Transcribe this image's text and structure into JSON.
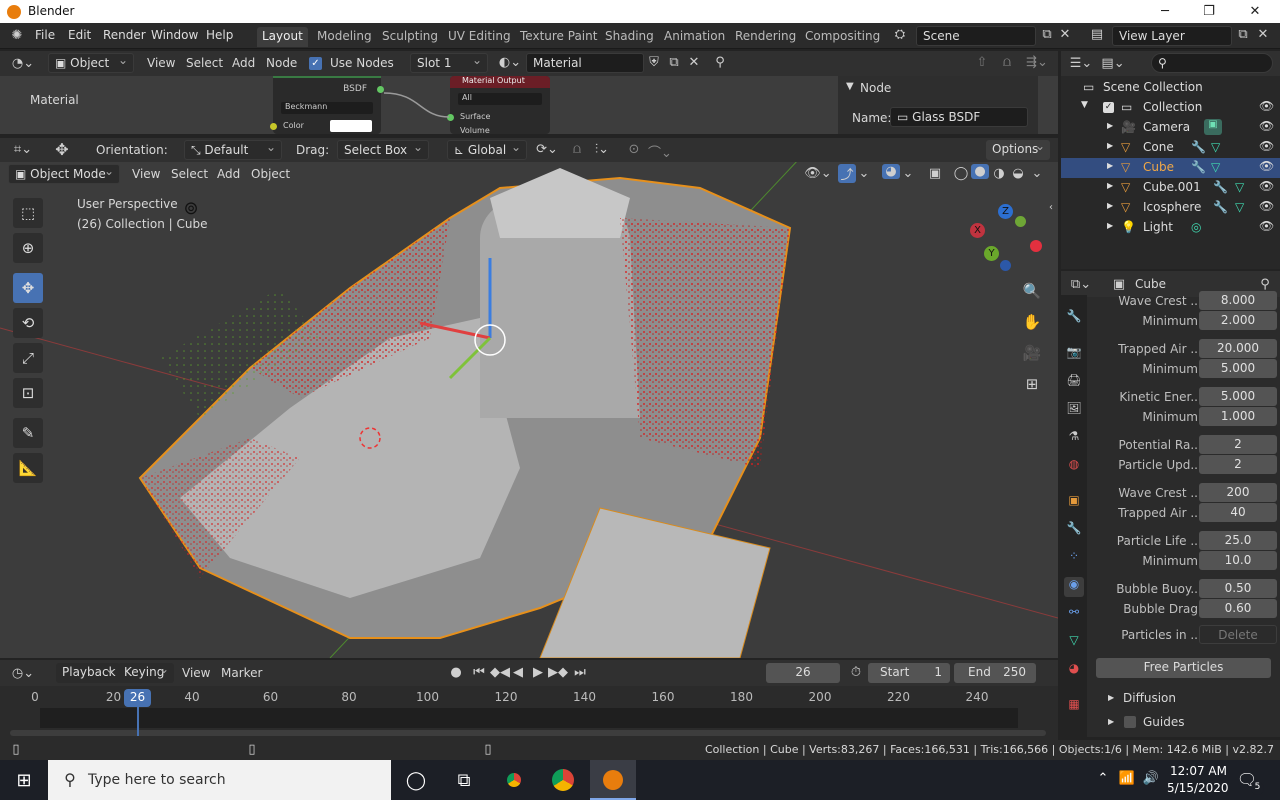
{
  "window": {
    "title": "Blender",
    "minimize": "─",
    "maximize": "❐",
    "close": "✕"
  },
  "menu": {
    "items": [
      "File",
      "Edit",
      "Render",
      "Window",
      "Help"
    ]
  },
  "workspaces": [
    "Layout",
    "Modeling",
    "Sculpting",
    "UV Editing",
    "Texture Paint",
    "Shading",
    "Animation",
    "Rendering",
    "Compositing"
  ],
  "scene": {
    "name": "Scene",
    "view_layer": "View Layer"
  },
  "node_editor": {
    "object_label": "Object",
    "menus": [
      "View",
      "Select",
      "Add",
      "Node"
    ],
    "use_nodes_label": "Use Nodes",
    "slot": "Slot 1",
    "material": "Material",
    "breadcrumb": "Material",
    "bsdf_output": "BSDF",
    "distribution": "Beckmann",
    "color_label": "Color",
    "output_node_title": "Material Output",
    "output_target": "All",
    "surface": "Surface",
    "volume": "Volume",
    "panel_title": "Node",
    "name_label": "Name:",
    "name_value": "Glass BSDF"
  },
  "viewport_header": {
    "orientation_label": "Orientation:",
    "orientation_value": "Default",
    "drag_label": "Drag:",
    "drag_value": "Select Box",
    "transform": "Global",
    "options": "Options",
    "mode": "Object Mode",
    "menus": [
      "View",
      "Select",
      "Add",
      "Object"
    ]
  },
  "viewport": {
    "perspective": "User Perspective",
    "context": "(26) Collection | Cube"
  },
  "gizmo": {
    "z": "Z",
    "x": "X",
    "y": "Y"
  },
  "outliner": {
    "root": "Scene Collection",
    "collection": "Collection",
    "items": [
      {
        "name": "Camera",
        "icon": "camera-icon"
      },
      {
        "name": "Cone",
        "icon": "mesh-icon"
      },
      {
        "name": "Cube",
        "icon": "mesh-icon",
        "selected": true
      },
      {
        "name": "Cube.001",
        "icon": "mesh-icon"
      },
      {
        "name": "Icosphere",
        "icon": "mesh-icon"
      },
      {
        "name": "Light",
        "icon": "light-icon"
      }
    ]
  },
  "properties": {
    "object": "Cube",
    "rows": [
      {
        "label": "Wave Crest ..",
        "value": "8.000"
      },
      {
        "label": "Minimum",
        "value": "2.000"
      },
      {
        "label": "Trapped Air ..",
        "value": "20.000"
      },
      {
        "label": "Minimum",
        "value": "5.000"
      },
      {
        "label": "Kinetic Ener..",
        "value": "5.000"
      },
      {
        "label": "Minimum",
        "value": "1.000"
      },
      {
        "label": "Potential Ra..",
        "value": "2"
      },
      {
        "label": "Particle Upd..",
        "value": "2"
      },
      {
        "label": "Wave Crest ..",
        "value": "200"
      },
      {
        "label": "Trapped Air ..",
        "value": "40"
      },
      {
        "label": "Particle Life ..",
        "value": "25.0"
      },
      {
        "label": "Minimum",
        "value": "10.0"
      },
      {
        "label": "Bubble Buoy..",
        "value": "0.50"
      },
      {
        "label": "Bubble Drag",
        "value": "0.60"
      }
    ],
    "particles_in_label": "Particles in ..",
    "particles_in_value": "Delete",
    "free_button": "Free Particles",
    "diffusion": "Diffusion",
    "guides": "Guides"
  },
  "timeline": {
    "playback": "Playback",
    "keying": "Keying",
    "view": "View",
    "marker": "Marker",
    "current_frame": "26",
    "start_label": "Start",
    "start": "1",
    "end_label": "End",
    "end": "250",
    "ticks": [
      "0",
      "20",
      "40",
      "60",
      "80",
      "100",
      "120",
      "140",
      "160",
      "180",
      "200",
      "220",
      "240"
    ],
    "playhead": "26"
  },
  "status": {
    "text": "Collection | Cube | Verts:83,267 | Faces:166,531 | Tris:166,566 | Objects:1/6 | Mem: 142.6 MiB | v2.82.7"
  },
  "taskbar": {
    "search_placeholder": "Type here to search",
    "time": "12:07 AM",
    "date": "5/15/2020",
    "notifications": "5"
  }
}
